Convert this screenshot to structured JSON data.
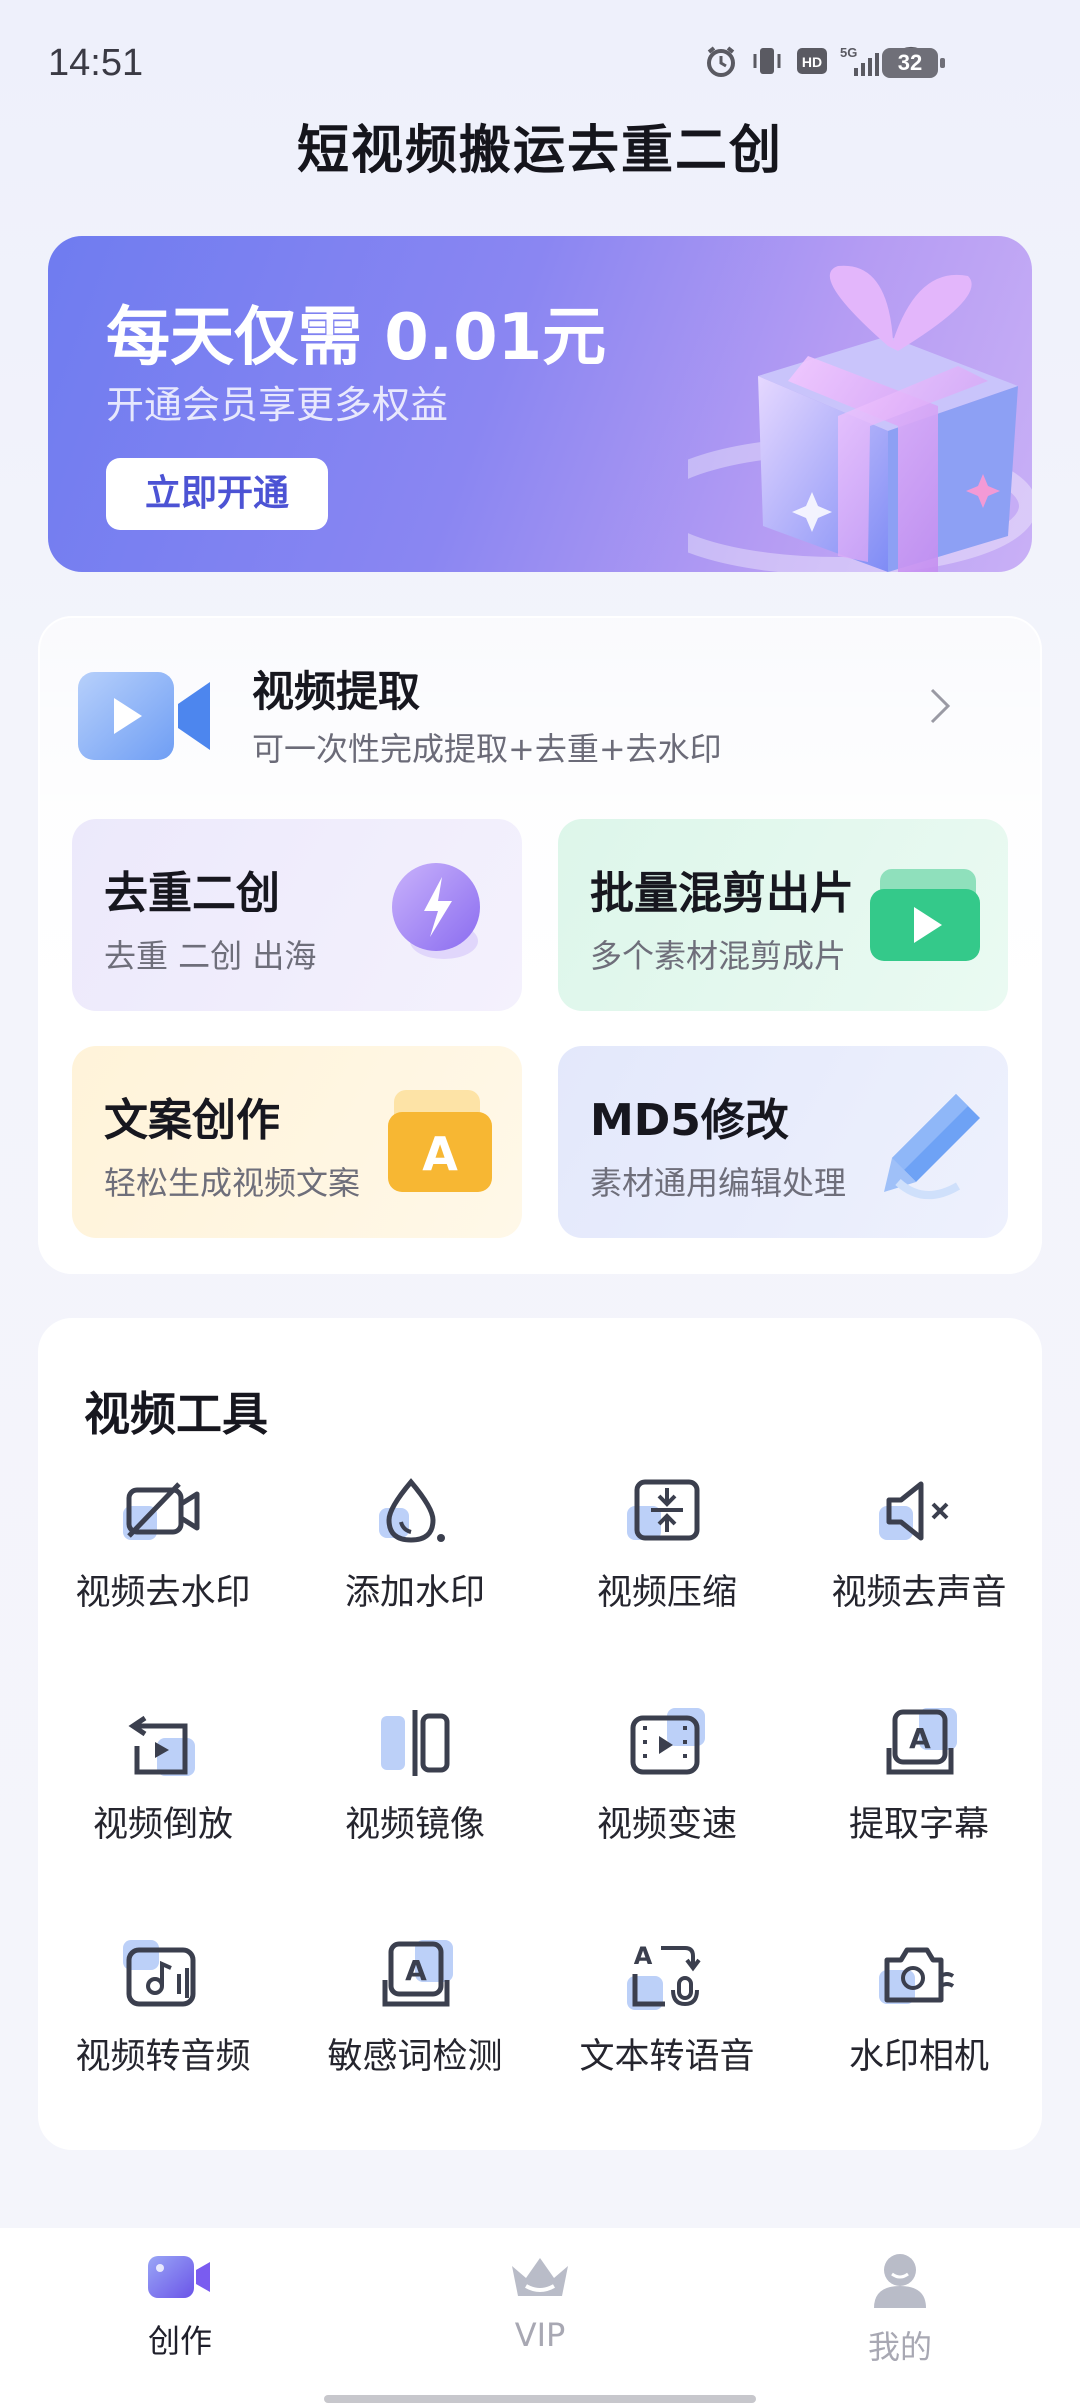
{
  "status_bar": {
    "time": "14:51",
    "battery": "32"
  },
  "app_title": "短视频搬运去重二创",
  "banner": {
    "title": "每天仅需 0.01元",
    "subtitle": "开通会员享更多权益",
    "button": "立即开通"
  },
  "extract": {
    "title": "视频提取",
    "subtitle": "可一次性完成提取+去重+去水印"
  },
  "tiles": [
    {
      "title": "去重二创",
      "subtitle": "去重  二创  出海"
    },
    {
      "title": "批量混剪出片",
      "subtitle": "多个素材混剪成片"
    },
    {
      "title": "文案创作",
      "subtitle": "轻松生成视频文案"
    },
    {
      "title": "MD5修改",
      "subtitle": "素材通用编辑处理"
    }
  ],
  "tools": {
    "title": "视频工具",
    "items": [
      {
        "label": "视频去水印",
        "icon": "camera-off-icon"
      },
      {
        "label": "添加水印",
        "icon": "water-drop-icon"
      },
      {
        "label": "视频压缩",
        "icon": "compress-icon"
      },
      {
        "label": "视频去声音",
        "icon": "mute-icon"
      },
      {
        "label": "视频倒放",
        "icon": "reverse-play-icon"
      },
      {
        "label": "视频镜像",
        "icon": "mirror-icon"
      },
      {
        "label": "视频变速",
        "icon": "film-speed-icon"
      },
      {
        "label": "提取字幕",
        "icon": "subtitle-icon"
      },
      {
        "label": "视频转音频",
        "icon": "video-to-audio-icon"
      },
      {
        "label": "敏感词检测",
        "icon": "text-check-icon"
      },
      {
        "label": "文本转语音",
        "icon": "text-to-speech-icon"
      },
      {
        "label": "水印相机",
        "icon": "watermark-camera-icon"
      }
    ]
  },
  "nav": {
    "items": [
      {
        "label": "创作",
        "active": true
      },
      {
        "label": "VIP",
        "active": false
      },
      {
        "label": "我的",
        "active": false
      }
    ]
  },
  "colors": {
    "accent": "#4c53d4",
    "nav_active": "#1f1f2b",
    "nav_inactive": "#a8a8b3",
    "icon_primary": "#3b3f4e",
    "icon_highlight": "#a9c2f7"
  }
}
